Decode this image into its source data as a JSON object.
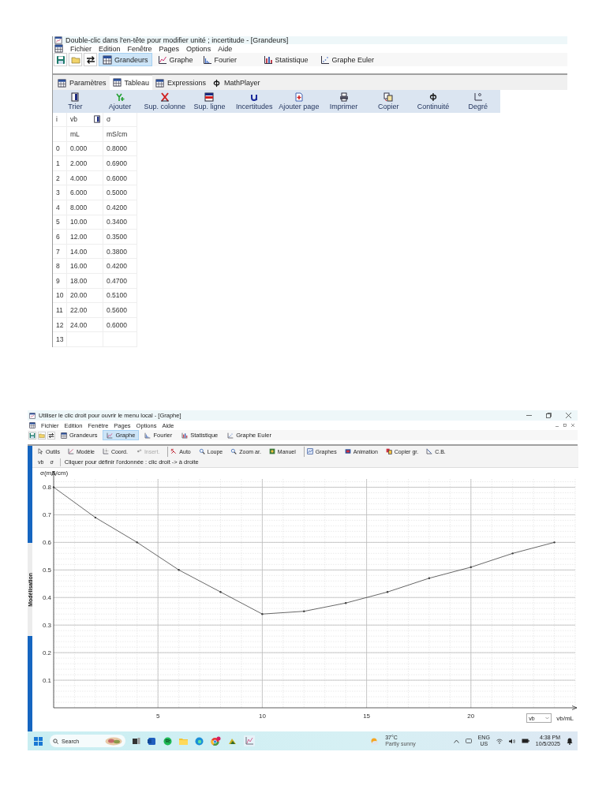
{
  "table_window": {
    "title": "Double-clic dans l'en-tête pour modifier unité ; incertitude - [Grandeurs]",
    "menu": [
      "Fichier",
      "Edition",
      "Fenêtre",
      "Pages",
      "Options",
      "Aide"
    ],
    "toolbar": [
      {
        "label": "Grandeurs",
        "selected": true
      },
      {
        "label": "Graphe",
        "selected": false
      },
      {
        "label": "Fourier",
        "selected": false
      },
      {
        "label": "Statistique",
        "selected": false
      },
      {
        "label": "Graphe Euler",
        "selected": false
      }
    ],
    "tabs": [
      {
        "label": "Paramètres",
        "selected": false
      },
      {
        "label": "Tableau",
        "selected": true
      },
      {
        "label": "Expressions",
        "selected": false
      },
      {
        "label": "MathPlayer",
        "selected": false
      }
    ],
    "actions": [
      "Trier",
      "Ajouter",
      "Sup. colonne",
      "Sup. ligne",
      "Incertitudes",
      "Ajouter page",
      "Imprimer",
      "Copier",
      "Continuité",
      "Degré"
    ],
    "table": {
      "columns": [
        {
          "name": "i"
        },
        {
          "name": "vb",
          "unit": "mL"
        },
        {
          "name": "σ",
          "unit": "mS/cm"
        }
      ],
      "rows": [
        [
          "0",
          "0.000",
          "0.8000"
        ],
        [
          "1",
          "2.000",
          "0.6900"
        ],
        [
          "2",
          "4.000",
          "0.6000"
        ],
        [
          "3",
          "6.000",
          "0.5000"
        ],
        [
          "4",
          "8.000",
          "0.4200"
        ],
        [
          "5",
          "10.00",
          "0.3400"
        ],
        [
          "6",
          "12.00",
          "0.3500"
        ],
        [
          "7",
          "14.00",
          "0.3800"
        ],
        [
          "8",
          "16.00",
          "0.4200"
        ],
        [
          "9",
          "18.00",
          "0.4700"
        ],
        [
          "10",
          "20.00",
          "0.5100"
        ],
        [
          "11",
          "22.00",
          "0.5600"
        ],
        [
          "12",
          "24.00",
          "0.6000"
        ]
      ],
      "new_row": "13"
    }
  },
  "graph_window": {
    "title": "Utiliser le clic droit pour ouvrir le menu local - [Graphe]",
    "menu": [
      "Fichier",
      "Edition",
      "Fenêtre",
      "Pages",
      "Options",
      "Aide"
    ],
    "toolbar": [
      {
        "label": "Grandeurs",
        "selected": false
      },
      {
        "label": "Graphe",
        "selected": true
      },
      {
        "label": "Fourier",
        "selected": false
      },
      {
        "label": "Statistique",
        "selected": false
      },
      {
        "label": "Graphe Euler",
        "selected": false
      }
    ],
    "graph_tools": [
      {
        "label": "Outils",
        "disabled": false,
        "group_start": false
      },
      {
        "label": "Modèle",
        "disabled": false,
        "group_start": false
      },
      {
        "label": "Coord.",
        "disabled": false,
        "group_start": false
      },
      {
        "label": "Insert.",
        "disabled": true,
        "group_start": false
      },
      {
        "label": "Auto",
        "disabled": false,
        "group_start": true
      },
      {
        "label": "Loupe",
        "disabled": false,
        "group_start": false
      },
      {
        "label": "Zoom ar.",
        "disabled": false,
        "group_start": false
      },
      {
        "label": "Manuel",
        "disabled": false,
        "group_start": false
      },
      {
        "label": "Graphes",
        "disabled": false,
        "group_start": true
      },
      {
        "label": "Animation",
        "disabled": false,
        "group_start": false
      },
      {
        "label": "Copier gr.",
        "disabled": false,
        "group_start": false
      },
      {
        "label": "C.B.",
        "disabled": false,
        "group_start": false
      }
    ],
    "axis_buttons": [
      "vb",
      "σ"
    ],
    "hint": "Cliquer pour définir l'ordonnée : clic droit -> à droite",
    "side_tab": "Modélisation",
    "x_select": "vb",
    "chart_data": {
      "type": "line",
      "xlabel": "vb/mL",
      "ylabel": "σ(mS/cm)",
      "x": [
        0,
        2,
        4,
        6,
        8,
        10,
        12,
        14,
        16,
        18,
        20,
        22,
        24
      ],
      "grid": true,
      "series": [
        {
          "color": "#404040",
          "values": [
            0.8,
            0.69,
            0.6,
            0.5,
            0.42,
            0.34,
            0.35,
            0.38,
            0.42,
            0.47,
            0.51,
            0.56,
            0.6
          ]
        }
      ],
      "xlim": [
        0,
        25
      ],
      "ylim": [
        0,
        0.83
      ],
      "xticks": [
        5,
        10,
        15,
        20
      ],
      "yticks": [
        0.1,
        0.2,
        0.3,
        0.4,
        0.5,
        0.6,
        0.7,
        0.8
      ]
    }
  },
  "taskbar": {
    "search": "Search",
    "weather": {
      "temperature": "37°C",
      "condition": "Partly sunny"
    },
    "language": [
      "ENG",
      "US"
    ],
    "time": "4:38 PM",
    "date": "10/5/2025"
  }
}
